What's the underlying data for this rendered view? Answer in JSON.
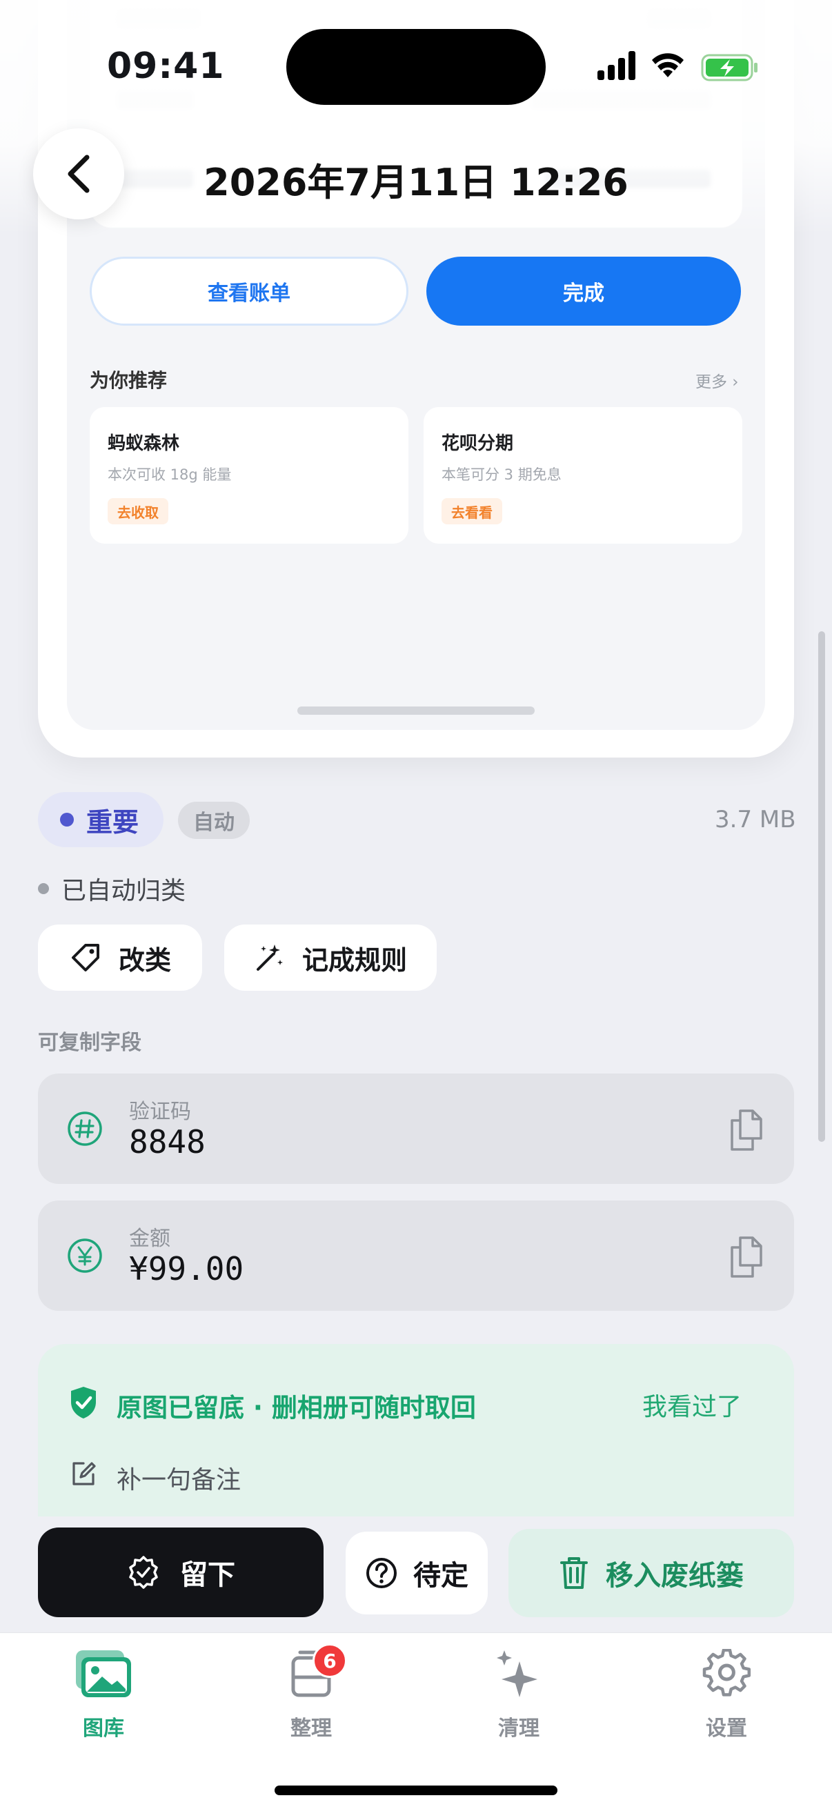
{
  "status_bar": {
    "time": "09:41"
  },
  "header": {
    "title": "2026年7月11日 12:26"
  },
  "preview": {
    "buttons": {
      "view_bill": "查看账单",
      "done": "完成"
    },
    "recommend_title": "为你推荐",
    "more": "更多 ›",
    "cards": [
      {
        "title": "蚂蚁森林",
        "subtitle": "本次可收 18g 能量",
        "tag": "去收取"
      },
      {
        "title": "花呗分期",
        "subtitle": "本笔可分 3 期免息",
        "tag": "去看看"
      }
    ]
  },
  "tags": {
    "important": "重要",
    "auto": "自动",
    "file_size": "3.7 MB"
  },
  "auto_status": "已自动归类",
  "actions_top": {
    "reclassify": "改类",
    "make_rule": "记成规则"
  },
  "copy_section": {
    "label": "可复制字段",
    "fields": [
      {
        "key": "验证码",
        "value": "8848",
        "icon": "hash-icon"
      },
      {
        "key": "金额",
        "value": "¥99.00",
        "icon": "yen-icon"
      }
    ]
  },
  "notice": {
    "message": "原图已留底 · 删相册可随时取回",
    "seen": "我看过了",
    "note": "补一句备注"
  },
  "action_bar": {
    "keep": "留下",
    "pending": "待定",
    "trash": "移入废纸篓"
  },
  "tabbar": {
    "items": [
      {
        "label": "图库",
        "icon": "gallery-icon",
        "active": true
      },
      {
        "label": "整理",
        "icon": "organize-icon",
        "badge": "6"
      },
      {
        "label": "清理",
        "icon": "sparkle-icon"
      },
      {
        "label": "设置",
        "icon": "gear-icon"
      }
    ]
  },
  "colors": {
    "primary_blue": "#1777f3",
    "accent_green": "#1fa57a",
    "important_purple": "#3e45c0",
    "badge_red": "#f0393a"
  }
}
